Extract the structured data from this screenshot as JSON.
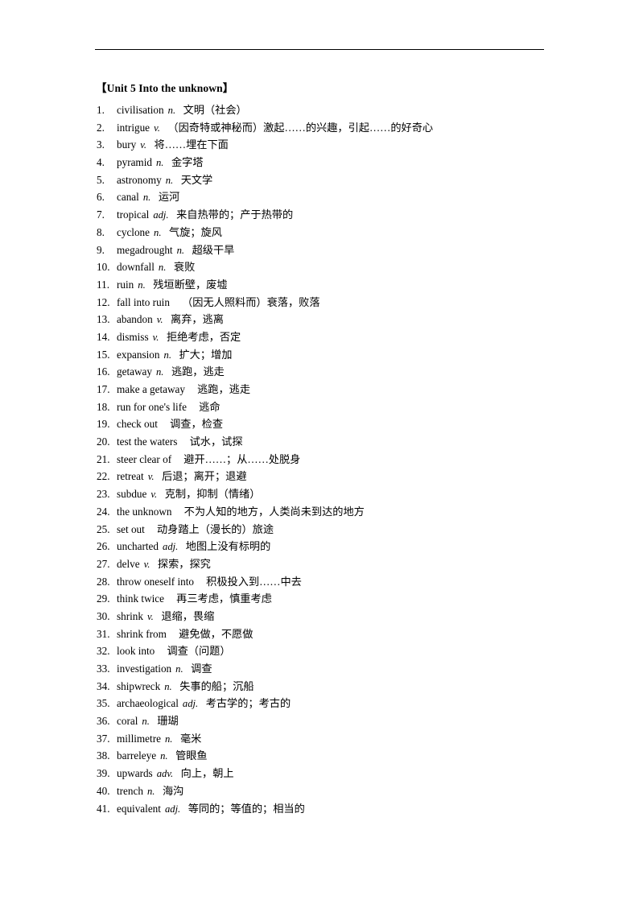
{
  "document": {
    "unit_title": "【Unit 5 Into the unknown】"
  },
  "vocabulary": [
    {
      "num": "1.",
      "term": "civilisation",
      "pos": "n.",
      "gloss": "文明（社会）",
      "gap": "sm"
    },
    {
      "num": "2.",
      "term": "intrigue",
      "pos": "v.",
      "gloss": "（因奇特或神秘而）激起……的兴趣，引起……的好奇心",
      "gap": "sm"
    },
    {
      "num": "3.",
      "term": "bury",
      "pos": "v.",
      "gloss": "将……埋在下面",
      "gap": "sm"
    },
    {
      "num": "4.",
      "term": "pyramid",
      "pos": "n.",
      "gloss": "金字塔",
      "gap": "sm"
    },
    {
      "num": "5.",
      "term": "astronomy",
      "pos": "n.",
      "gloss": "天文学",
      "gap": "sm"
    },
    {
      "num": "6.",
      "term": "canal",
      "pos": "n.",
      "gloss": "运河",
      "gap": "sm"
    },
    {
      "num": "7.",
      "term": "tropical",
      "pos": "adj.",
      "gloss": "来自热带的；产于热带的",
      "gap": "sm"
    },
    {
      "num": "8.",
      "term": "cyclone",
      "pos": "n.",
      "gloss": "气旋；旋风",
      "gap": "sm"
    },
    {
      "num": "9.",
      "term": "megadrought",
      "pos": "n.",
      "gloss": "超级干旱",
      "gap": "sm"
    },
    {
      "num": "10.",
      "term": "downfall",
      "pos": "n.",
      "gloss": "衰败",
      "gap": "sm"
    },
    {
      "num": "11.",
      "term": "ruin",
      "pos": "n.",
      "gloss": "残垣断壁，废墟",
      "gap": "sm"
    },
    {
      "num": "12.",
      "term": "fall into ruin",
      "pos": "",
      "gloss": "（因无人照料而）衰落，败落",
      "gap": "md"
    },
    {
      "num": "13.",
      "term": "abandon",
      "pos": "v.",
      "gloss": "离弃，逃离",
      "gap": "sm"
    },
    {
      "num": "14.",
      "term": "dismiss",
      "pos": "v.",
      "gloss": "拒绝考虑，否定",
      "gap": "sm"
    },
    {
      "num": "15.",
      "term": "expansion",
      "pos": "n.",
      "gloss": "扩大；增加",
      "gap": "sm"
    },
    {
      "num": "16.",
      "term": "getaway",
      "pos": "n.",
      "gloss": "逃跑，逃走",
      "gap": "sm"
    },
    {
      "num": "17.",
      "term": "make a getaway",
      "pos": "",
      "gloss": "逃跑，逃走",
      "gap": "md"
    },
    {
      "num": "18.",
      "term": "run for one's life",
      "pos": "",
      "gloss": "逃命",
      "gap": "md"
    },
    {
      "num": "19.",
      "term": "check out",
      "pos": "",
      "gloss": "调查，检查",
      "gap": "md"
    },
    {
      "num": "20.",
      "term": "test the waters",
      "pos": "",
      "gloss": "试水，试探",
      "gap": "md"
    },
    {
      "num": "21.",
      "term": "steer clear of",
      "pos": "",
      "gloss": "避开……；从……处脱身",
      "gap": "md"
    },
    {
      "num": "22.",
      "term": "retreat",
      "pos": "v.",
      "gloss": "后退；离开；退避",
      "gap": "sm"
    },
    {
      "num": "23.",
      "term": "subdue",
      "pos": "v.",
      "gloss": "克制，抑制（情绪）",
      "gap": "sm"
    },
    {
      "num": "24.",
      "term": "the unknown",
      "pos": "",
      "gloss": "不为人知的地方，人类尚未到达的地方",
      "gap": "md"
    },
    {
      "num": "25.",
      "term": "set out",
      "pos": "",
      "gloss": "动身踏上（漫长的）旅途",
      "gap": "md"
    },
    {
      "num": "26.",
      "term": "uncharted",
      "pos": "adj.",
      "gloss": "地图上没有标明的",
      "gap": "sm"
    },
    {
      "num": "27.",
      "term": "delve",
      "pos": "v.",
      "gloss": "探索，探究",
      "gap": "sm"
    },
    {
      "num": "28.",
      "term": "throw oneself into",
      "pos": "",
      "gloss": "积极投入到……中去",
      "gap": "md"
    },
    {
      "num": "29.",
      "term": "think twice",
      "pos": "",
      "gloss": "再三考虑，慎重考虑",
      "gap": "md"
    },
    {
      "num": "30.",
      "term": "shrink",
      "pos": "v.",
      "gloss": "退缩，畏缩",
      "gap": "sm"
    },
    {
      "num": "31.",
      "term": "shrink from",
      "pos": "",
      "gloss": "避免做，不愿做",
      "gap": "md"
    },
    {
      "num": "32.",
      "term": "look into",
      "pos": "",
      "gloss": "调查（问题）",
      "gap": "md"
    },
    {
      "num": "33.",
      "term": "investigation",
      "pos": "n.",
      "gloss": "调查",
      "gap": "sm"
    },
    {
      "num": "34.",
      "term": "shipwreck",
      "pos": "n.",
      "gloss": "失事的船；沉船",
      "gap": "sm"
    },
    {
      "num": "35.",
      "term": "archaeological",
      "pos": "adj.",
      "gloss": "考古学的；考古的",
      "gap": "sm"
    },
    {
      "num": "36.",
      "term": "coral",
      "pos": "n.",
      "gloss": "珊瑚",
      "gap": "sm"
    },
    {
      "num": "37.",
      "term": "millimetre",
      "pos": "n.",
      "gloss": "毫米",
      "gap": "sm"
    },
    {
      "num": "38.",
      "term": "barreleye",
      "pos": "n.",
      "gloss": "管眼鱼",
      "gap": "sm"
    },
    {
      "num": "39.",
      "term": "upwards",
      "pos": "adv.",
      "gloss": "向上，朝上",
      "gap": "sm"
    },
    {
      "num": "40.",
      "term": "trench",
      "pos": "n.",
      "gloss": "海沟",
      "gap": "sm"
    },
    {
      "num": "41.",
      "term": "equivalent",
      "pos": "adj.",
      "gloss": "等同的；等值的；相当的",
      "gap": "sm"
    }
  ]
}
